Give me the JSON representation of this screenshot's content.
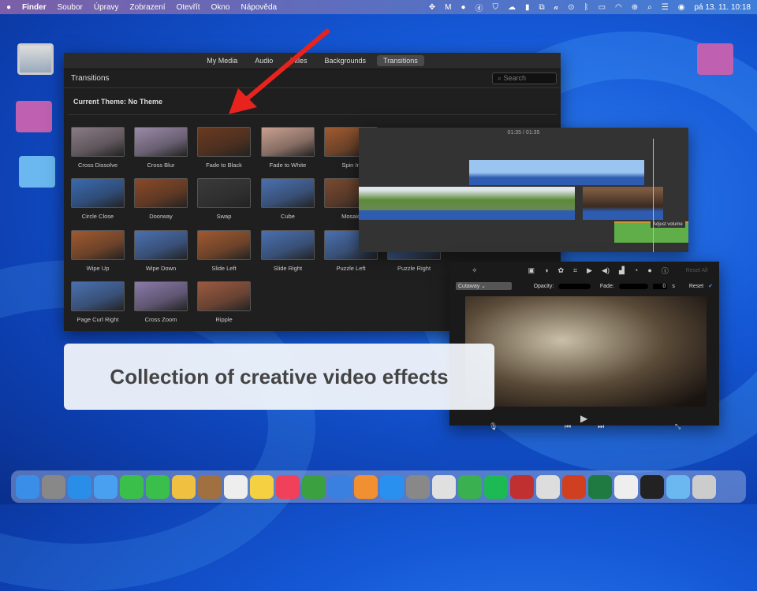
{
  "menubar": {
    "apple": "",
    "items": [
      "Finder",
      "Soubor",
      "Úpravy",
      "Zobrazení",
      "Otevřít",
      "Okno",
      "Nápověda"
    ],
    "clock": "pá 13. 11.  10:18"
  },
  "transitions_window": {
    "tabs": [
      "My Media",
      "Audio",
      "Titles",
      "Backgrounds",
      "Transitions"
    ],
    "active_tab": "Transitions",
    "title": "Transitions",
    "search_placeholder": "Search",
    "theme": "Current Theme: No Theme",
    "items": [
      {
        "label": "Cross Dissolve",
        "color": "#8a7b84"
      },
      {
        "label": "Cross Blur",
        "color": "#9a8aa8"
      },
      {
        "label": "Fade to Black",
        "color": "#6a3a20"
      },
      {
        "label": "Fade to White",
        "color": "#c9a090"
      },
      {
        "label": "Spin In",
        "color": "#a05a30"
      },
      {
        "label": "Circle Close",
        "color": "#3a6ab0"
      },
      {
        "label": "Doorway",
        "color": "#8a4a28"
      },
      {
        "label": "Swap",
        "color": "#3a3a3a"
      },
      {
        "label": "Cube",
        "color": "#4a70b0"
      },
      {
        "label": "Mosaic",
        "color": "#7a4a30"
      },
      {
        "label": "Wipe Up",
        "color": "#a05a30"
      },
      {
        "label": "Wipe Down",
        "color": "#4a70b0"
      },
      {
        "label": "Slide Left",
        "color": "#a05a30"
      },
      {
        "label": "Slide Right",
        "color": "#4a70b0"
      },
      {
        "label": "Puzzle Left",
        "color": "#4a70b0"
      },
      {
        "label": "Puzzle Right",
        "color": "#4a70b0"
      },
      {
        "label": "Page Curl Right",
        "color": "#4a70b0"
      },
      {
        "label": "Cross Zoom",
        "color": "#8a7aa8"
      },
      {
        "label": "Ripple",
        "color": "#9a5a40"
      }
    ]
  },
  "timeline": {
    "time_current": "01:35",
    "time_total": "01:35",
    "tooltip": "Adjust volume"
  },
  "viewer": {
    "overlay_mode": "Cutaway",
    "opacity_label": "Opacity:",
    "fade_label": "Fade:",
    "fade_value": "0",
    "fade_unit": "s",
    "reset": "Reset",
    "reset_all": "Reset All"
  },
  "caption": "Collection of creative video effects"
}
